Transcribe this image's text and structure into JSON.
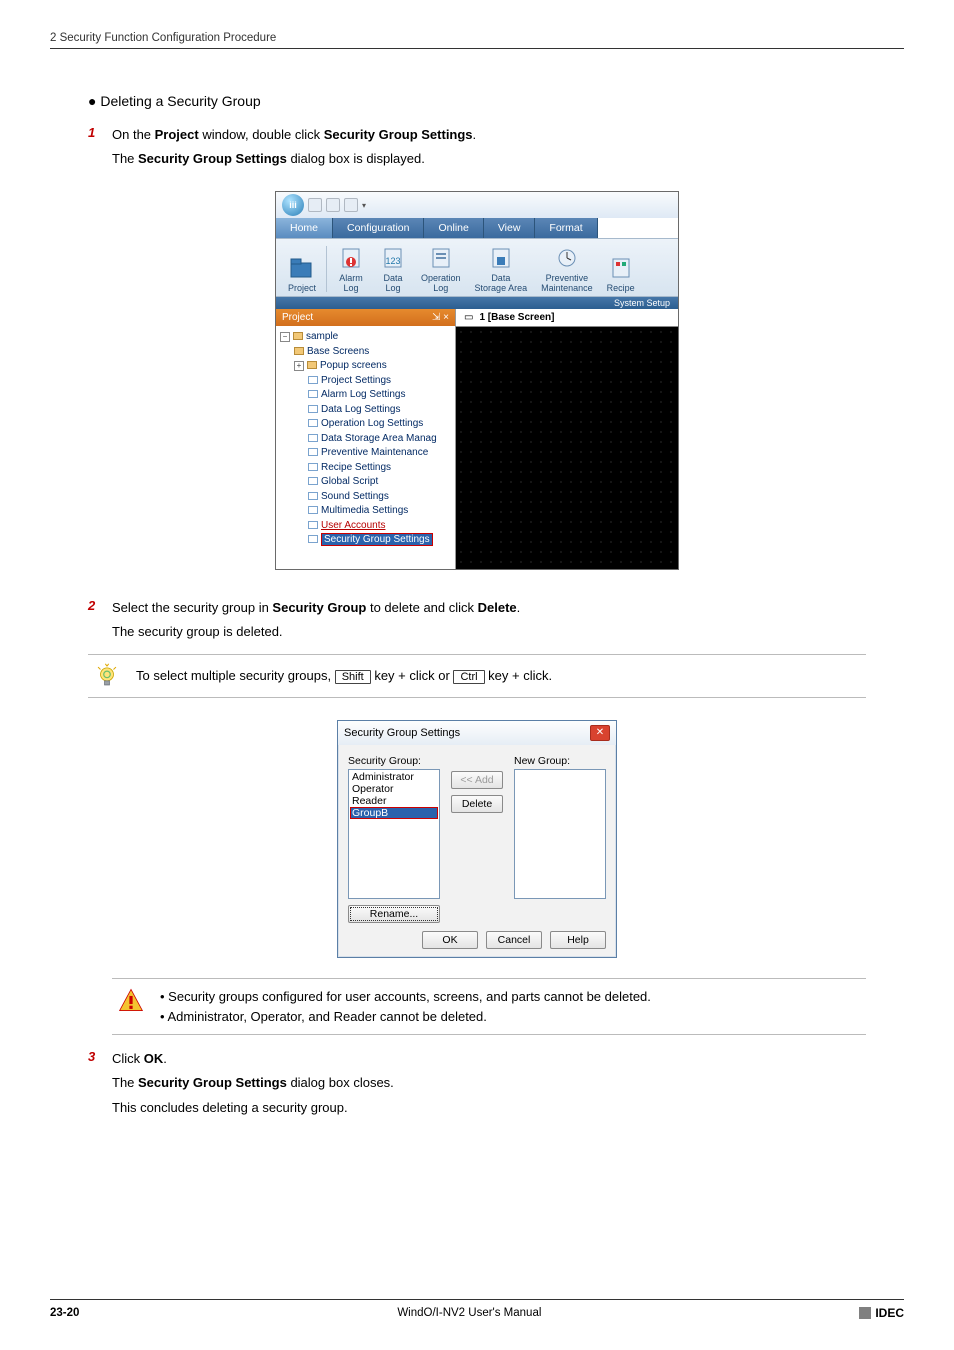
{
  "header": "2 Security Function Configuration Procedure",
  "section_title": "Deleting a Security Group",
  "steps": {
    "s1": {
      "num": "1",
      "line_pre": "On the ",
      "b1": "Project",
      "mid1": " window, double click ",
      "b2": "Security Group Settings",
      "post1": ".",
      "line2_pre": "The ",
      "b3": "Security Group Settings",
      "line2_post": " dialog box is displayed."
    },
    "s2": {
      "num": "2",
      "line_pre": "Select the security group in ",
      "b1": "Security Group",
      "mid1": " to delete and click ",
      "b2": "Delete",
      "post1": ".",
      "line2": "The security group is deleted."
    },
    "s3": {
      "num": "3",
      "line_pre": "Click ",
      "b1": "OK",
      "post1": ".",
      "line2_pre": "The ",
      "b2": "Security Group Settings",
      "line2_post": " dialog box closes.",
      "line3": "This concludes deleting a security group."
    }
  },
  "tip": {
    "pre": "To select multiple security groups, ",
    "key1": "Shift",
    "mid1": " key + click or ",
    "key2": "Ctrl",
    "post": " key + click."
  },
  "warn": {
    "b1": "Security groups configured for user accounts, screens, and parts cannot be deleted.",
    "b2": "Administrator, Operator, and Reader cannot be deleted."
  },
  "app": {
    "tabs": {
      "home": "Home",
      "configuration": "Configuration",
      "online": "Online",
      "view": "View",
      "format": "Format"
    },
    "ribbon": {
      "project": "Project",
      "alarm_log": "Alarm\nLog",
      "data_log": "Data\nLog",
      "operation_log": "Operation\nLog",
      "data_storage": "Data\nStorage Area",
      "preventive": "Preventive\nMaintenance",
      "recipe": "Recipe",
      "group_title": "System Setup"
    },
    "project_panel": {
      "title": "Project",
      "pin_close": "⇲  ×",
      "tree": {
        "root": "sample",
        "base_screens": "Base Screens",
        "popup_screens": "Popup screens",
        "project_settings": "Project Settings",
        "alarm_log": "Alarm Log Settings",
        "data_log": "Data Log Settings",
        "op_log": "Operation Log Settings",
        "storage": "Data Storage Area Manag",
        "prevent": "Preventive Maintenance",
        "recipe": "Recipe Settings",
        "global_script": "Global Script",
        "sound": "Sound Settings",
        "multimedia": "Multimedia Settings",
        "user_accounts": "User Accounts",
        "sec_group": "Security Group Settings"
      }
    },
    "canvas_tab_icon": "▭",
    "canvas_tab": "1  [Base Screen]"
  },
  "dialog": {
    "title": "Security Group Settings",
    "sg_label": "Security Group:",
    "ng_label": "New Group:",
    "items": {
      "admin": "Administrator",
      "operator": "Operator",
      "reader": "Reader",
      "groupb": "GroupB"
    },
    "add": "<< Add",
    "delete": "Delete",
    "rename": "Rename...",
    "ok": "OK",
    "cancel": "Cancel",
    "help": "Help"
  },
  "footer": {
    "page": "23-20",
    "title": "WindO/I-NV2 User's Manual",
    "brand": "IDEC"
  }
}
